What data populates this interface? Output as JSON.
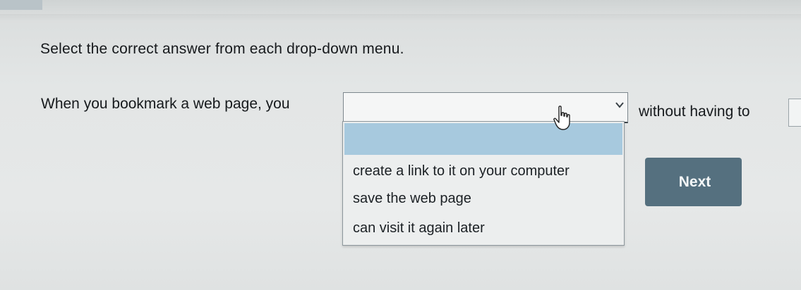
{
  "question": {
    "instruction": "Select the correct answer from each drop-down menu.",
    "prompt_before": "When you bookmark a web page, you",
    "prompt_after": "without having to"
  },
  "dropdown": {
    "selected_value": "",
    "options": [
      "",
      "create a link to it on your computer",
      "save the web page",
      "can visit it again later"
    ],
    "highlight_color": "#a7c9de"
  },
  "second_dropdown": {
    "selected_value": ""
  },
  "icons": {
    "select_chevron": "chevron-down-icon",
    "cursor": "hand-pointer-icon"
  },
  "actions": {
    "next_label": "Next",
    "next_color": "#55707f"
  }
}
